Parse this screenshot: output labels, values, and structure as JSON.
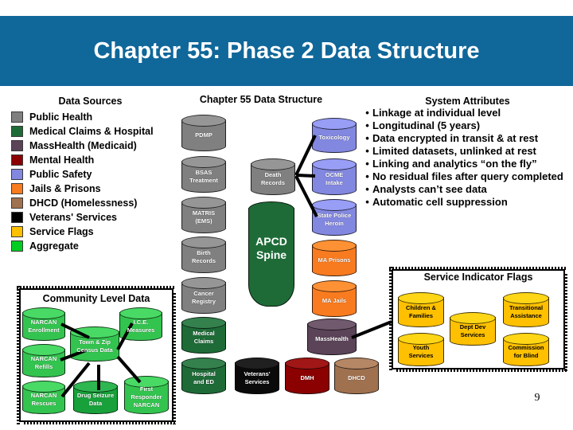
{
  "slide": {
    "title": "Chapter 55: Phase 2 Data Structure",
    "banner_color": "#10679a",
    "page_number": "9"
  },
  "legend": {
    "title": "Data Sources",
    "items": [
      {
        "label": "Public Health",
        "color": "#808080"
      },
      {
        "label": "Medical Claims & Hospital",
        "color": "#1e6b37"
      },
      {
        "label": "MassHealth (Medicaid)",
        "color": "#5b4358"
      },
      {
        "label": "Mental Health",
        "color": "#8b0000"
      },
      {
        "label": "Public Safety",
        "color": "#8287e0"
      },
      {
        "label": "Jails & Prisons",
        "color": "#f97b1f"
      },
      {
        "label": "DHCD (Homelessness)",
        "color": "#a0714f"
      },
      {
        "label": "Veterans' Services",
        "color": "#000000"
      },
      {
        "label": "Service Flags",
        "color": "#ffc000"
      },
      {
        "label": "Aggregate",
        "color": "#00cc22"
      }
    ]
  },
  "structure": {
    "title": "Chapter 55 Data Structure",
    "spine": {
      "label_line1": "APCD",
      "label_line2": "Spine",
      "color": "#1e6b37"
    },
    "nodes": [
      {
        "id": "pdmp",
        "lines": [
          "PDMP"
        ],
        "color": "#808080"
      },
      {
        "id": "bsas",
        "lines": [
          "BSAS",
          "Treatment"
        ],
        "color": "#808080"
      },
      {
        "id": "matris",
        "lines": [
          "MATRIS",
          "(EMS)"
        ],
        "color": "#808080"
      },
      {
        "id": "birth",
        "lines": [
          "Birth",
          "Records"
        ],
        "color": "#808080"
      },
      {
        "id": "cancer",
        "lines": [
          "Cancer",
          "Registry"
        ],
        "color": "#808080"
      },
      {
        "id": "death",
        "lines": [
          "Death",
          "Records"
        ],
        "color": "#808080"
      },
      {
        "id": "medclaims",
        "lines": [
          "Medical",
          "Claims"
        ],
        "color": "#1e6b37"
      },
      {
        "id": "hospital",
        "lines": [
          "Hospital",
          "and ED"
        ],
        "color": "#1e6b37"
      },
      {
        "id": "toxicology",
        "lines": [
          "Toxicology"
        ],
        "color": "#8287e0"
      },
      {
        "id": "ocme",
        "lines": [
          "OCME",
          "Intake"
        ],
        "color": "#8287e0"
      },
      {
        "id": "statepolice",
        "lines": [
          "State Police",
          "Heroin"
        ],
        "color": "#8287e0"
      },
      {
        "id": "maprisons",
        "lines": [
          "MA Prisons"
        ],
        "color": "#f97b1f"
      },
      {
        "id": "majails",
        "lines": [
          "MA Jails"
        ],
        "color": "#f97b1f"
      },
      {
        "id": "masshealth",
        "lines": [
          "MassHealth"
        ],
        "color": "#5b4358"
      },
      {
        "id": "veterans",
        "lines": [
          "Veterans'",
          "Services"
        ],
        "color": "#0a0a0a"
      },
      {
        "id": "dmh",
        "lines": [
          "DMH"
        ],
        "color": "#8b0000"
      },
      {
        "id": "dhcd",
        "lines": [
          "DHCD"
        ],
        "color": "#a0714f"
      }
    ]
  },
  "community": {
    "title": "Community Level Data",
    "nodes": [
      {
        "id": "narcan-enrollment",
        "lines": [
          "NARCAN",
          "Enrollment"
        ],
        "color": "#33c44f"
      },
      {
        "id": "narcan-refills",
        "lines": [
          "NARCAN",
          "Refills"
        ],
        "color": "#33c44f"
      },
      {
        "id": "narcan-rescues",
        "lines": [
          "NARCAN",
          "Rescues"
        ],
        "color": "#33c44f"
      },
      {
        "id": "town-zip-census",
        "lines": [
          "Town & Zip",
          "Census Data"
        ],
        "color": "#33c44f"
      },
      {
        "id": "ice-measures",
        "lines": [
          "I.C.E.",
          "Measures"
        ],
        "color": "#33c44f"
      },
      {
        "id": "drug-seizure",
        "lines": [
          "Drug Seizure",
          "Data"
        ],
        "color": "#18a13a"
      },
      {
        "id": "first-responder",
        "lines": [
          "First",
          "Responder",
          "NARCAN"
        ],
        "color": "#33c44f"
      }
    ]
  },
  "attributes": {
    "title": "System Attributes",
    "bullet_glyph": "•",
    "items": [
      "Linkage at individual level",
      "Longitudinal (5 years)",
      "Data encrypted in transit & at rest",
      "Limited datasets, unlinked at rest",
      "Linking and analytics “on the fly”",
      "No residual files after query completed",
      "Analysts can’t see data",
      "Automatic cell suppression"
    ]
  },
  "service_flags": {
    "title": "Service Indicator Flags",
    "nodes": [
      {
        "id": "children-families",
        "lines": [
          "Children &",
          "Families"
        ],
        "color": "#ffc000"
      },
      {
        "id": "youth-services",
        "lines": [
          "Youth",
          "Services"
        ],
        "color": "#ffc000"
      },
      {
        "id": "dept-dev-services",
        "lines": [
          "Dept Dev",
          "Services"
        ],
        "color": "#ffc000"
      },
      {
        "id": "transitional-assist",
        "lines": [
          "Transitional",
          "Assistance"
        ],
        "color": "#ffc000"
      },
      {
        "id": "commission-blind",
        "lines": [
          "Commission",
          "for Blind"
        ],
        "color": "#ffc000"
      }
    ]
  }
}
